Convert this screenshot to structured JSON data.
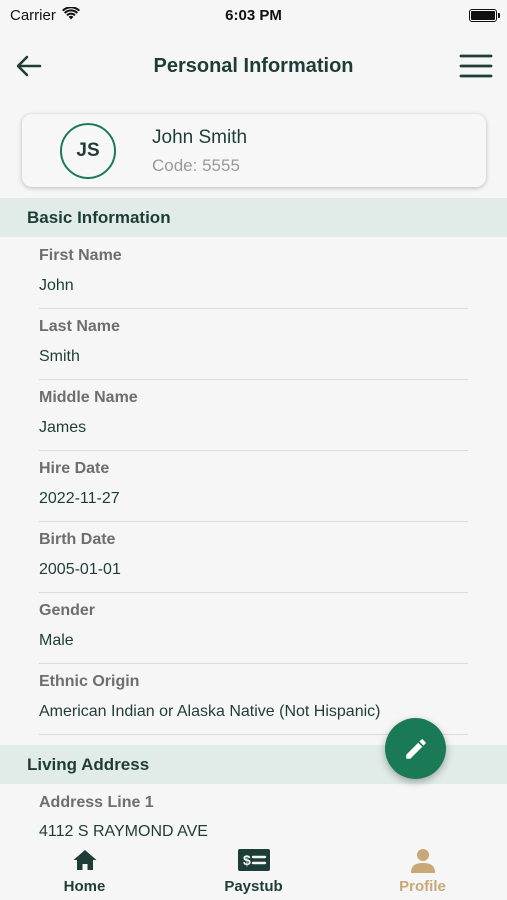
{
  "status_bar": {
    "carrier": "Carrier",
    "time": "6:03 PM",
    "battery_level": 1.0
  },
  "nav": {
    "title": "Personal Information",
    "back_icon": "arrow-left-icon",
    "menu_icon": "hamburger-menu-icon"
  },
  "profile": {
    "initials": "JS",
    "name": "John Smith",
    "code": "Code: 5555"
  },
  "sections": {
    "basic": {
      "title": "Basic Information",
      "fields": [
        {
          "label": "First Name",
          "value": "John"
        },
        {
          "label": "Last Name",
          "value": "Smith"
        },
        {
          "label": "Middle Name",
          "value": "James"
        },
        {
          "label": "Hire Date",
          "value": "2022-11-27"
        },
        {
          "label": "Birth Date",
          "value": "2005-01-01"
        },
        {
          "label": "Gender",
          "value": "Male"
        },
        {
          "label": "Ethnic Origin",
          "value": "American Indian or Alaska Native (Not Hispanic)"
        }
      ]
    },
    "address": {
      "title": "Living Address",
      "fields": [
        {
          "label": "Address Line 1",
          "value": "4112 S RAYMOND AVE"
        }
      ]
    }
  },
  "fab": {
    "icon": "pencil-icon"
  },
  "tabs": [
    {
      "label": "Home",
      "icon": "home-icon",
      "active": false
    },
    {
      "label": "Paystub",
      "icon": "paystub-icon",
      "active": false
    },
    {
      "label": "Profile",
      "icon": "person-icon",
      "active": true
    }
  ],
  "colors": {
    "primary": "#1a7a56",
    "dark_text": "#1f3d37",
    "section_bg": "#e1ebe8",
    "active_tab": "#c8a877"
  }
}
